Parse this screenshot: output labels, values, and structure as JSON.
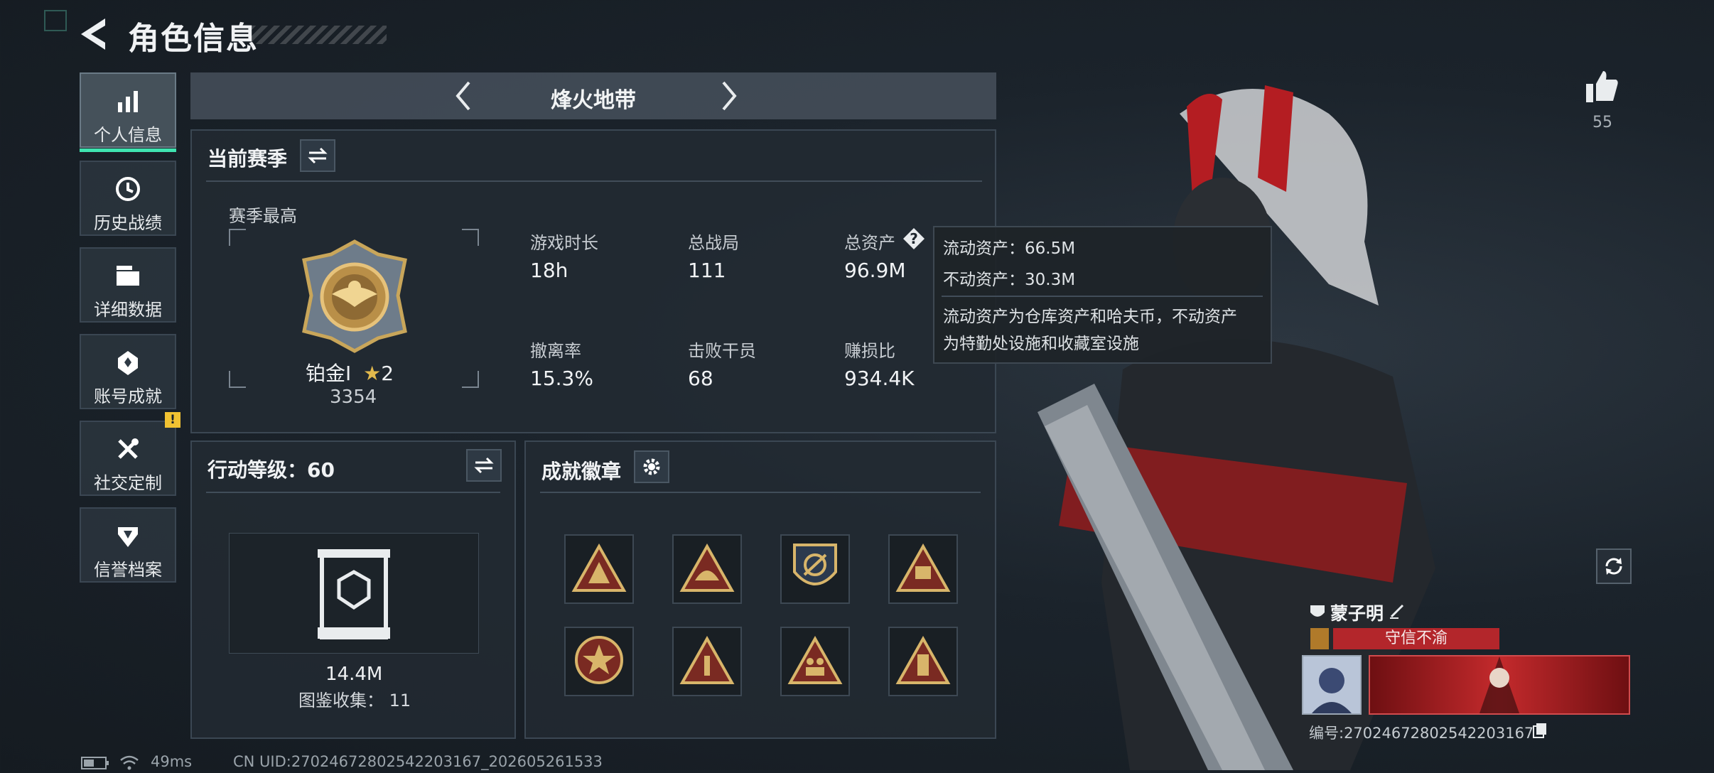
{
  "header": {
    "title": "角色信息"
  },
  "sidebar": {
    "items": [
      {
        "label": "个人信息",
        "icon": "bar-chart-icon",
        "active": true
      },
      {
        "label": "历史战绩",
        "icon": "history-icon"
      },
      {
        "label": "详细数据",
        "icon": "folder-icon"
      },
      {
        "label": "账号成就",
        "icon": "achievement-icon"
      },
      {
        "label": "社交定制",
        "icon": "tools-icon",
        "badge": "!"
      },
      {
        "label": "信誉档案",
        "icon": "credit-shield-icon"
      }
    ]
  },
  "mode": {
    "title": "烽火地带"
  },
  "season": {
    "title": "当前赛季",
    "best_label": "赛季最高",
    "rank_name": "铂金Ⅰ",
    "rank_stars": "2",
    "rank_score": "3354",
    "stats": [
      {
        "label": "游戏时长",
        "value": "18h"
      },
      {
        "label": "总战局",
        "value": "111"
      },
      {
        "label": "总资产",
        "value": "96.9M"
      },
      {
        "label": "撤离率",
        "value": "15.3%"
      },
      {
        "label": "击败干员",
        "value": "68"
      },
      {
        "label": "赚损比",
        "value": "934.4K"
      }
    ]
  },
  "tooltip": {
    "liquid": "流动资产：66.5M",
    "fixed": "不动资产：30.3M",
    "note_line1": "流动资产为仓库资产和哈夫币，不动资产",
    "note_line2": "为特勤处设施和收藏室设施"
  },
  "level": {
    "title": "行动等级：60",
    "value": "14.4M",
    "collection": "图鉴收集：  11"
  },
  "achievements": {
    "title": "成就徽章",
    "badges": [
      "triangle-badge-camp",
      "triangle-badge-helmet",
      "shield-badge-emblem",
      "triangle-badge-58",
      "round-badge-star",
      "triangle-badge-1",
      "triangle-badge-figures",
      "triangle-badge-tower"
    ]
  },
  "right": {
    "like_count": "55",
    "player_name": "蒙子明",
    "player_tag": "守信不渝",
    "player_id": "编号:270246728025422031​67"
  },
  "status_bar": {
    "ping": "49ms",
    "uid": "CN UID:270246728025422031​67_202605261533"
  },
  "colors": {
    "accent": "#3fe3b0",
    "warning": "#f1c232",
    "tag_red": "#b3262b"
  }
}
